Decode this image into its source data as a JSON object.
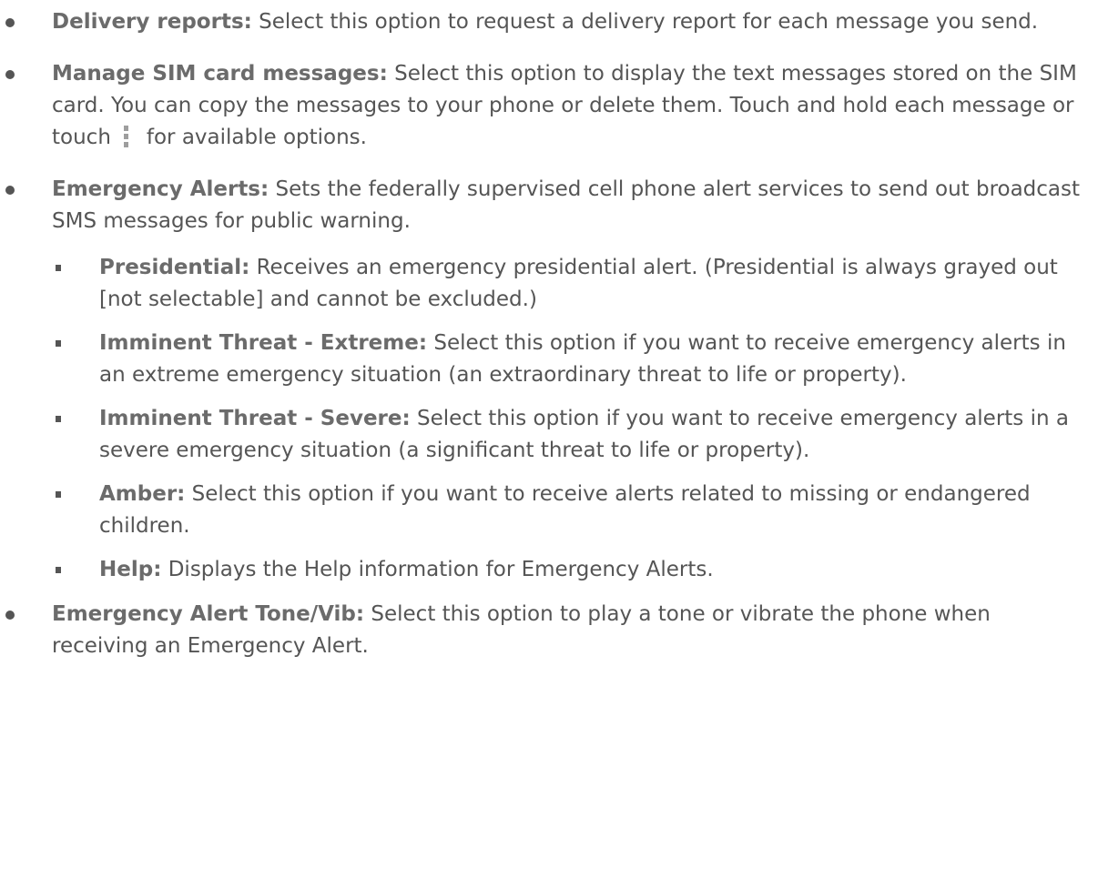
{
  "items": [
    {
      "term": "Delivery reports:",
      "text": " Select this option to request a delivery report for each message you send."
    },
    {
      "term": "Manage SIM card messages:",
      "text_before_icon": " Select this option to display the text messages stored on the SIM card. You can copy the messages to your phone or delete them. Touch and hold each message or touch",
      "icon": "menu-icon",
      "text_after_icon": "for available options."
    },
    {
      "term": "Emergency Alerts:",
      "text": " Sets the federally supervised cell phone alert services to send out broadcast SMS messages for public warning.",
      "subitems": [
        {
          "term": "Presidential:",
          "text": " Receives an emergency presidential alert. (Presidential is always grayed out [not selectable] and cannot be excluded.)"
        },
        {
          "term": "Imminent Threat - Extreme:",
          "text": " Select this option if you want to receive emergency alerts in an extreme emergency situation (an extraordinary threat to life or property)."
        },
        {
          "term": "Imminent Threat - Severe:",
          "text": " Select this option if you want to receive emergency alerts in a severe emergency situation (a significant threat to life or property)."
        },
        {
          "term": "Amber:",
          "text": " Select this option if you want to receive alerts related to missing or endangered children."
        },
        {
          "term": "Help:",
          "text": " Displays the Help information for Emergency Alerts."
        }
      ]
    },
    {
      "term": "Emergency Alert Tone/Vib:",
      "text": " Select this option to play a tone or vibrate the phone when receiving an Emergency Alert."
    }
  ]
}
